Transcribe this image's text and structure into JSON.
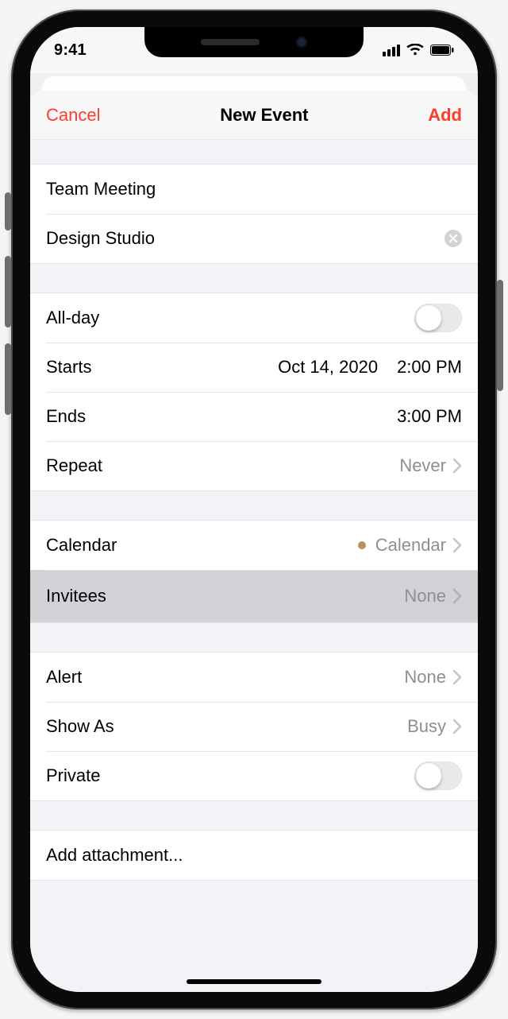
{
  "status": {
    "time": "9:41"
  },
  "nav": {
    "cancel": "Cancel",
    "title": "New Event",
    "add": "Add"
  },
  "event": {
    "title": "Team Meeting",
    "location": "Design Studio",
    "all_day_label": "All-day",
    "starts_label": "Starts",
    "starts_date": "Oct 14, 2020",
    "starts_time": "2:00 PM",
    "ends_label": "Ends",
    "ends_time": "3:00 PM",
    "repeat_label": "Repeat",
    "repeat_value": "Never",
    "calendar_label": "Calendar",
    "calendar_value": "Calendar",
    "invitees_label": "Invitees",
    "invitees_value": "None",
    "alert_label": "Alert",
    "alert_value": "None",
    "show_as_label": "Show As",
    "show_as_value": "Busy",
    "private_label": "Private",
    "attachment_label": "Add attachment..."
  }
}
